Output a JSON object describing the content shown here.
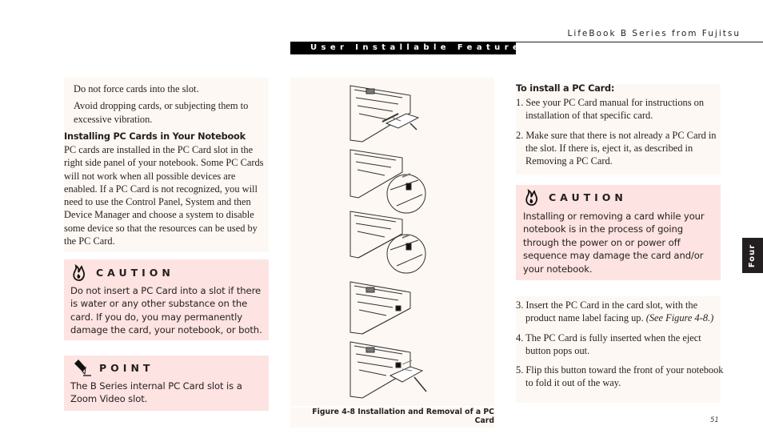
{
  "header": {
    "running_head": "LifeBook B Series from Fujitsu",
    "section_title": "User Installable Features"
  },
  "left_column": {
    "bullets": [
      "Do not force cards into the slot.",
      "Avoid dropping cards, or subjecting them to excessive vibration."
    ],
    "heading": "Installing PC Cards in Your Notebook",
    "paragraph": "PC cards are installed in the PC Card slot in the right side panel of your notebook. Some PC Cards will not work when all possible devices are enabled. If a PC Card is not recognized, you will need to use the Control Panel, System and then Device Manager and choose a system to disable some device so that the resources can be used by the PC Card.",
    "caution": {
      "icon": "flame-icon",
      "title": "CAUTION",
      "body": "Do not insert a PC Card into a slot if there is water or any other substance on the card. If you do, you may permanently damage the card, your notebook, or both."
    },
    "point": {
      "icon": "pen-icon",
      "title": "POINT",
      "body": "The B Series internal PC Card slot is a Zoom Video slot."
    }
  },
  "figure": {
    "caption": "Figure 4-8 Installation and Removal of a PC Card",
    "illustrations": [
      "insert-card",
      "eject-button-detail",
      "fold-button-detail",
      "card-inserted",
      "remove-card"
    ]
  },
  "right_column": {
    "heading": "To install a PC Card:",
    "steps_a": [
      "1. See your PC Card manual for instructions on installation of that specific card.",
      "2. Make sure that there is not already a PC Card in the slot. If there is, eject it, as described in Removing a PC Card."
    ],
    "caution": {
      "icon": "flame-icon",
      "title": "CAUTION",
      "body": "Installing or removing a card while your notebook is in the process of going through the power on or power off sequence may damage the card and/or your notebook."
    },
    "step3": "3. Insert the PC Card in the card slot, with the product name label facing up.",
    "step3_ref": "(See Figure 4-8.)",
    "step4": "4. The PC Card is fully inserted when the eject button pops out.",
    "step5": "5. Flip this button toward the front of your notebook to fold it out of the way."
  },
  "chapter_tab": "Four",
  "page_number": "51"
}
